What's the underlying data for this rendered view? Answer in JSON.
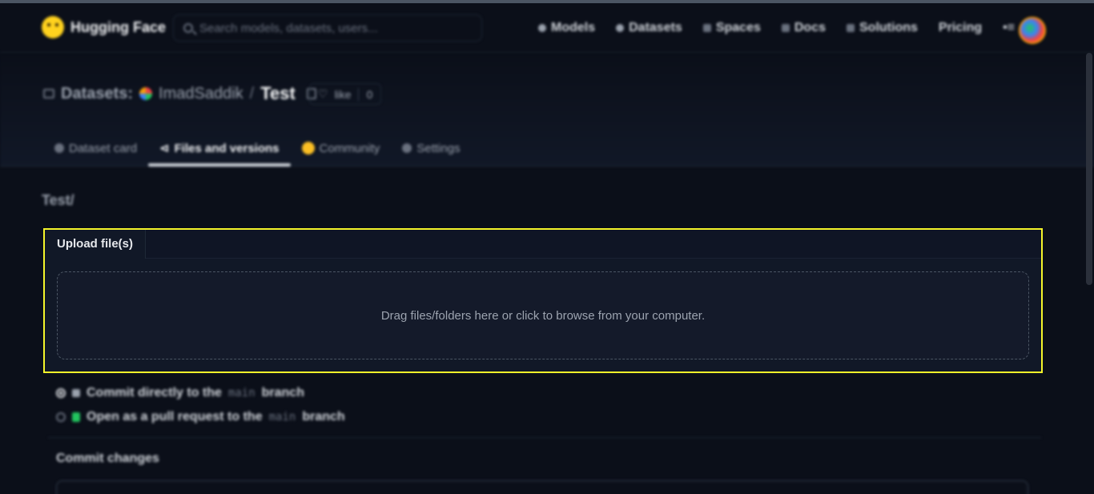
{
  "header": {
    "brand": "Hugging Face",
    "search_placeholder": "Search models, datasets, users...",
    "nav": [
      {
        "label": "Models",
        "icon": "models-icon"
      },
      {
        "label": "Datasets",
        "icon": "datasets-icon"
      },
      {
        "label": "Spaces",
        "icon": "spaces-icon"
      },
      {
        "label": "Docs",
        "icon": "docs-icon"
      },
      {
        "label": "Solutions",
        "icon": "solutions-icon"
      },
      {
        "label": "Pricing",
        "icon": ""
      }
    ]
  },
  "repo": {
    "kind": "Datasets:",
    "owner": "ImadSaddik",
    "separator": "/",
    "name": "Test",
    "like_label": "like",
    "like_count": "0"
  },
  "tabs": [
    {
      "label": "Dataset card",
      "active": false
    },
    {
      "label": "Files and versions",
      "active": true
    },
    {
      "label": "Community",
      "active": false
    },
    {
      "label": "Settings",
      "active": false
    }
  ],
  "path": "Test/",
  "upload": {
    "tab_label": "Upload file(s)",
    "dropzone_text": "Drag files/folders here or click to browse from your computer."
  },
  "commit": {
    "option_direct_prefix": "Commit directly to the",
    "option_pr_prefix": "Open as a pull request to the",
    "branch_code": "main",
    "branch_suffix": "branch",
    "title": "Commit changes"
  },
  "colors": {
    "background": "#0b0f19",
    "highlight_border": "#f5f52a",
    "brand_yellow": "#ffd21e"
  }
}
